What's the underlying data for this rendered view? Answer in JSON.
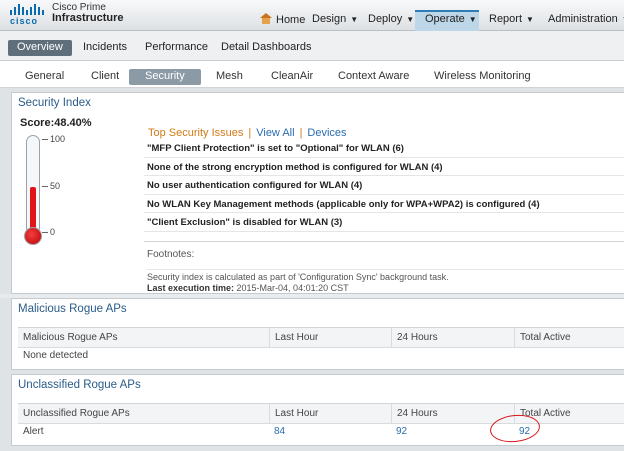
{
  "brand": {
    "logo_text": "cisco",
    "product_line1": "Cisco Prime",
    "product_line2": "Infrastructure"
  },
  "menu": {
    "items": [
      {
        "label": "Home",
        "icon": "home-icon",
        "caret": ""
      },
      {
        "label": "Design",
        "caret": "▼"
      },
      {
        "label": "Deploy",
        "caret": "▼"
      },
      {
        "label": "Operate",
        "caret": "▼",
        "active": true
      },
      {
        "label": "Report",
        "caret": "▼"
      },
      {
        "label": "Administration",
        "caret": "▼"
      }
    ]
  },
  "tabs": [
    {
      "label": "Overview",
      "active": true
    },
    {
      "label": "Incidents"
    },
    {
      "label": "Performance"
    },
    {
      "label": "Detail Dashboards"
    }
  ],
  "subtabs": [
    {
      "label": "General"
    },
    {
      "label": "Client"
    },
    {
      "label": "Security",
      "active": true
    },
    {
      "label": "Mesh"
    },
    {
      "label": "CleanAir"
    },
    {
      "label": "Context Aware"
    },
    {
      "label": "Wireless Monitoring"
    }
  ],
  "security_index": {
    "title": "Security Index",
    "score_label": "Score:48.40%",
    "score_value": 48.4,
    "gauge_ticks": [
      "100",
      "50",
      "0"
    ],
    "issues_header": {
      "title": "Top Security Issues",
      "sep1": "|",
      "view_all": "View All",
      "sep2": "|",
      "devices": "Devices"
    },
    "issues": [
      "\"MFP Client Protection\" is set to \"Optional\" for WLAN  (6)",
      "None of the strong encryption method is configured for WLAN  (4)",
      "No user authentication configured for WLAN  (4)",
      "No WLAN Key Management methods (applicable only for WPA+WPA2) is configured  (4)",
      "\"Client Exclusion\" is disabled for WLAN  (3)"
    ],
    "footnotes_title": "Footnotes:",
    "footnote_desc": "Security index is calculated as part of 'Configuration Sync' background task.",
    "exec_label": "Last execution time:",
    "exec_value": " 2015-Mar-04, 04:01:20 CST"
  },
  "malicious": {
    "title": "Malicious Rogue APs",
    "headers": [
      "Malicious Rogue APs",
      "Last Hour",
      "24 Hours",
      "Total Active"
    ],
    "row": [
      "None detected",
      "",
      "",
      ""
    ]
  },
  "unclassified": {
    "title": "Unclassified Rogue APs",
    "headers": [
      "Unclassified Rogue APs",
      "Last Hour",
      "24 Hours",
      "Total Active"
    ],
    "row": [
      "Alert",
      "84",
      "92",
      "92"
    ]
  },
  "colors": {
    "accent": "#2a6db0",
    "issue_header": "#d17a16",
    "gauge": "#e0151a",
    "annotation": "#d8141a"
  }
}
